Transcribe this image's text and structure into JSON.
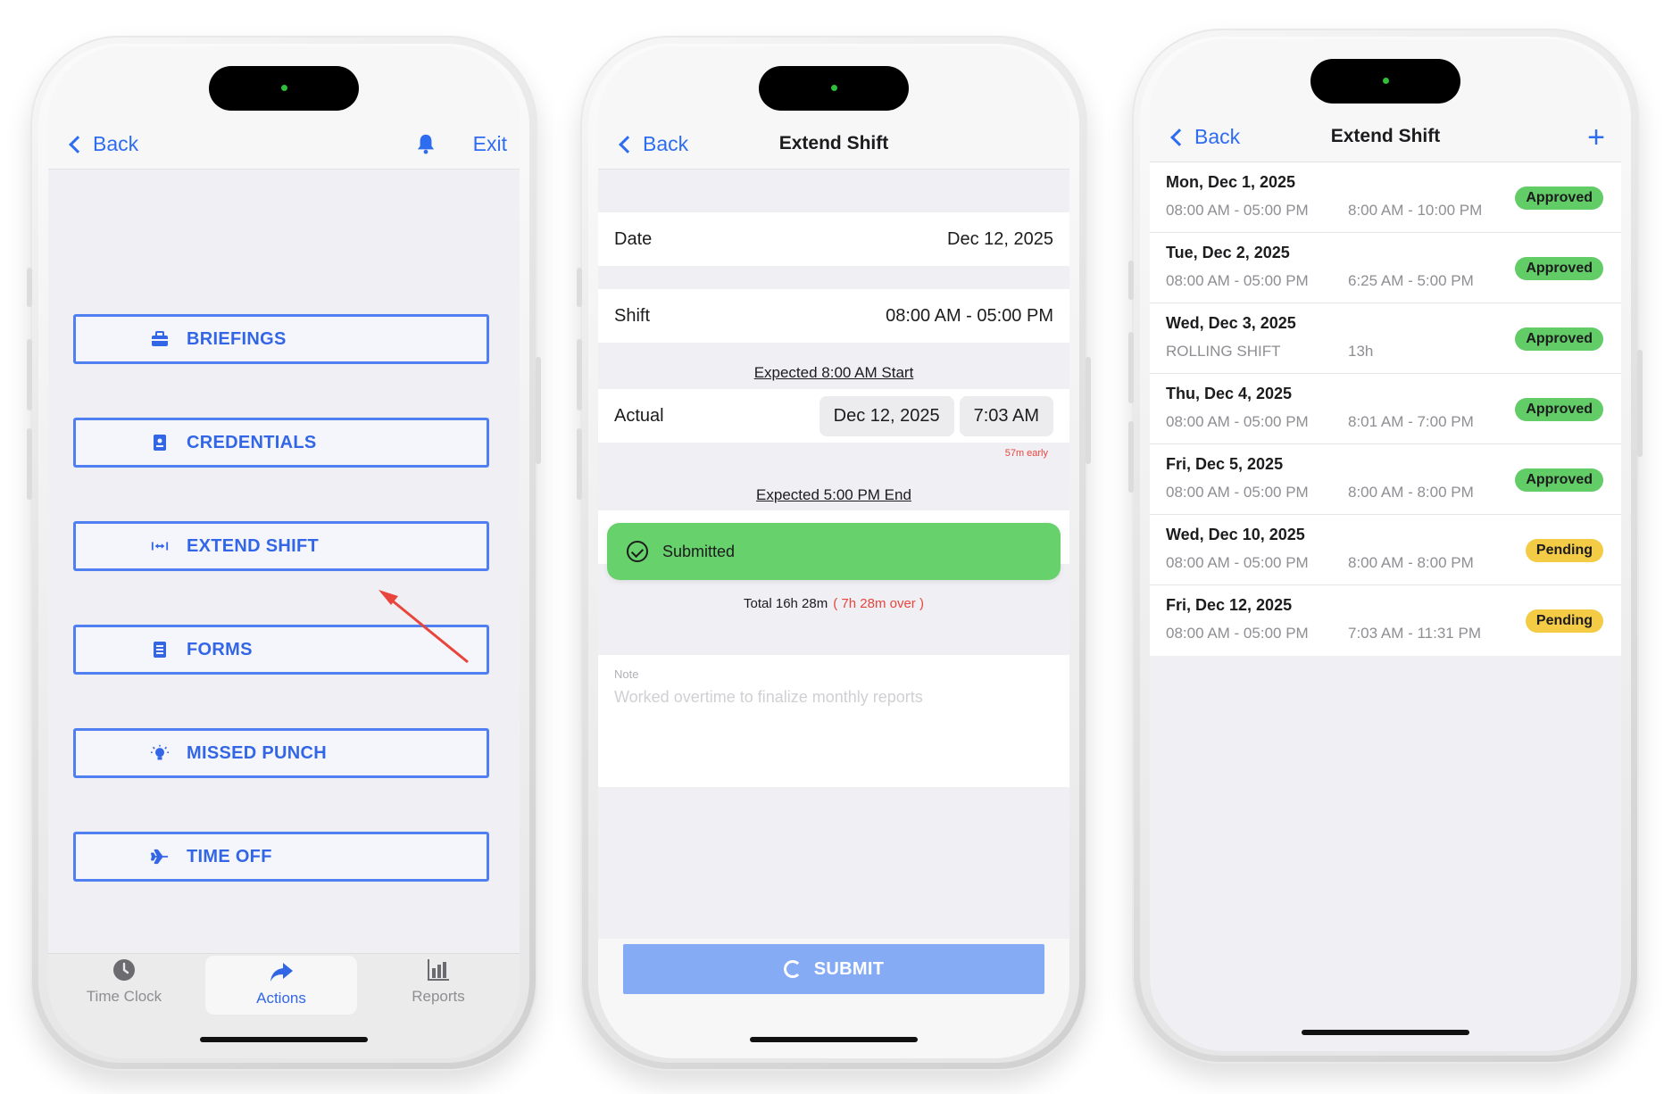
{
  "screen1": {
    "back_label": "Back",
    "exit_label": "Exit",
    "actions": [
      {
        "label": "BRIEFINGS",
        "icon": "briefcase-icon"
      },
      {
        "label": "CREDENTIALS",
        "icon": "id-badge-icon"
      },
      {
        "label": "EXTEND SHIFT",
        "icon": "extend-arrows-icon"
      },
      {
        "label": "FORMS",
        "icon": "form-list-icon"
      },
      {
        "label": "MISSED PUNCH",
        "icon": "lightbulb-icon"
      },
      {
        "label": "TIME OFF",
        "icon": "airplane-icon"
      }
    ],
    "tabs": [
      {
        "label": "Time Clock",
        "icon": "clock-icon"
      },
      {
        "label": "Actions",
        "icon": "share-arrow-icon"
      },
      {
        "label": "Reports",
        "icon": "bar-chart-icon"
      }
    ],
    "active_tab": "Actions",
    "annotation_color": "#e8453c"
  },
  "screen2": {
    "back_label": "Back",
    "title": "Extend Shift",
    "date_label": "Date",
    "date_value": "Dec 12, 2025",
    "shift_label": "Shift",
    "shift_value": "08:00 AM - 05:00 PM",
    "expected_start": "Expected 8:00 AM Start",
    "actual_label": "Actual",
    "actual_date": "Dec 12, 2025",
    "actual_time": "7:03 AM",
    "early_note": "57m early",
    "expected_end": "Expected 5:00 PM End",
    "toast_text": "Submitted",
    "total_text": "Total 16h 28m",
    "over_text": "( 7h 28m over )",
    "note_label": "Note",
    "note_placeholder": "Worked overtime to finalize monthly reports",
    "submit_label": "SUBMIT"
  },
  "screen3": {
    "back_label": "Back",
    "title": "Extend Shift",
    "add_label": "+",
    "entries": [
      {
        "date": "Mon, Dec 1, 2025",
        "scheduled": "08:00 AM - 05:00 PM",
        "actual": "8:00 AM - 10:00 PM",
        "status": "Approved"
      },
      {
        "date": "Tue, Dec 2, 2025",
        "scheduled": "08:00 AM - 05:00 PM",
        "actual": "6:25 AM - 5:00 PM",
        "status": "Approved"
      },
      {
        "date": "Wed, Dec 3, 2025",
        "scheduled": "ROLLING SHIFT",
        "actual": "13h",
        "status": "Approved"
      },
      {
        "date": "Thu, Dec 4, 2025",
        "scheduled": "08:00 AM - 05:00 PM",
        "actual": "8:01 AM - 7:00 PM",
        "status": "Approved"
      },
      {
        "date": "Fri, Dec 5, 2025",
        "scheduled": "08:00 AM - 05:00 PM",
        "actual": "8:00 AM - 8:00 PM",
        "status": "Approved"
      },
      {
        "date": "Wed, Dec 10, 2025",
        "scheduled": "08:00 AM - 05:00 PM",
        "actual": "8:00 AM - 8:00 PM",
        "status": "Pending"
      },
      {
        "date": "Fri, Dec 12, 2025",
        "scheduled": "08:00 AM - 05:00 PM",
        "actual": "7:03 AM - 11:31 PM",
        "status": "Pending"
      }
    ],
    "status_colors": {
      "Approved": "#62cc67",
      "Pending": "#f4cb45"
    }
  },
  "accent_color": "#2e6cf0"
}
